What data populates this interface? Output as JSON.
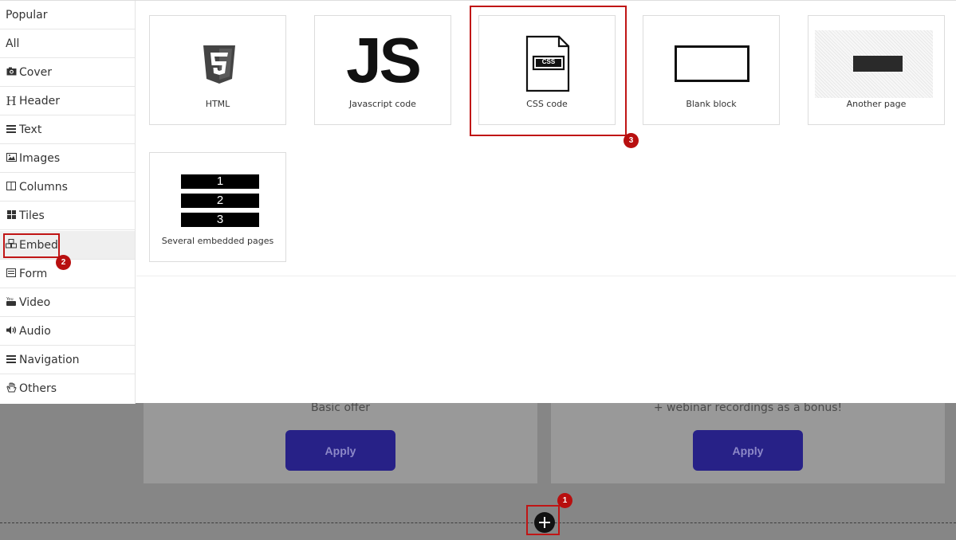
{
  "sidebar": {
    "items": [
      {
        "label": "Popular",
        "icon": ""
      },
      {
        "label": "All",
        "icon": ""
      },
      {
        "label": "Cover",
        "icon": "camera-icon"
      },
      {
        "label": "Header",
        "icon": "header-h-icon"
      },
      {
        "label": "Text",
        "icon": "text-lines-icon"
      },
      {
        "label": "Images",
        "icon": "image-icon"
      },
      {
        "label": "Columns",
        "icon": "columns-icon"
      },
      {
        "label": "Tiles",
        "icon": "tiles-icon"
      },
      {
        "label": "Embed",
        "icon": "cubes-icon"
      },
      {
        "label": "Form",
        "icon": "form-icon"
      },
      {
        "label": "Video",
        "icon": "youtube-icon"
      },
      {
        "label": "Audio",
        "icon": "speaker-icon"
      },
      {
        "label": "Navigation",
        "icon": "menu-icon"
      },
      {
        "label": "Others",
        "icon": "hand-icon"
      }
    ],
    "active": "Embed"
  },
  "tiles": [
    {
      "label": "HTML",
      "icon": "html5-icon"
    },
    {
      "label": "Javascript code",
      "icon": "js-icon",
      "icon_text": "JS"
    },
    {
      "label": "CSS code",
      "icon": "css-file-icon",
      "icon_text": "CSS"
    },
    {
      "label": "Blank block",
      "icon": "blank-block-icon"
    },
    {
      "label": "Another page",
      "icon": "another-page-thumbnail"
    },
    {
      "label": "Several embedded pages",
      "icon": "embedded-pages-icon",
      "numbers": [
        "1",
        "2",
        "3"
      ]
    }
  ],
  "background": {
    "cards": [
      {
        "text": "Basic offer",
        "button": "Apply"
      },
      {
        "text": "+ webinar recordings as a bonus!",
        "button": "Apply"
      }
    ]
  },
  "badges": [
    "1",
    "2",
    "3"
  ],
  "colors": {
    "highlight": "#c01515",
    "badge": "#b80f0f",
    "apply_button": "#272187",
    "overlay": "#868686"
  }
}
